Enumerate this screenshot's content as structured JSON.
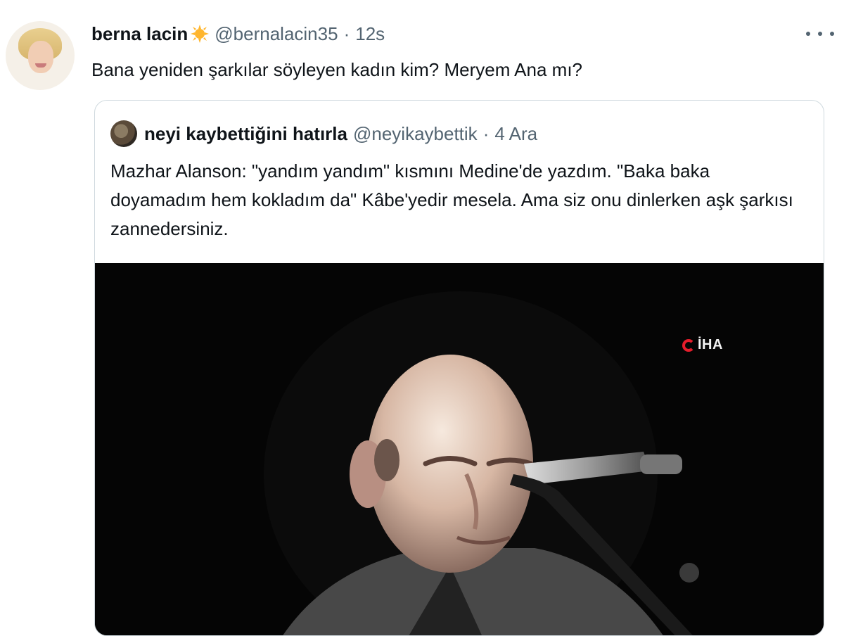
{
  "tweet": {
    "author_name": "berna lacin",
    "author_badge_icon": "sun-emoji-icon",
    "author_handle": "@bernalacin35",
    "separator": "·",
    "time": "12s",
    "text": "Bana yeniden şarkılar söyleyen kadın kim? Meryem Ana mı?",
    "more_icon": "more-options-icon"
  },
  "quoted_tweet": {
    "author_name": "neyi kaybettiğini hatırla",
    "author_handle": "@neyikaybettik",
    "separator": "·",
    "date": "4 Ara",
    "text": "Mazhar Alanson: \"yandım yandım\" kısmını Medine'de yazdım. \"Baka baka doyamadım hem kokladım da\" Kâbe'yedir mesela. Ama siz onu dinlerken aşk şarkısı zannedersiniz.",
    "media": {
      "watermark": "İHA",
      "description_icon": "video-thumbnail"
    }
  },
  "colors": {
    "text_primary": "#0f1419",
    "text_secondary": "#536471",
    "border": "#cfd9de",
    "media_bg": "#050505",
    "watermark_red": "#e51d2b"
  }
}
